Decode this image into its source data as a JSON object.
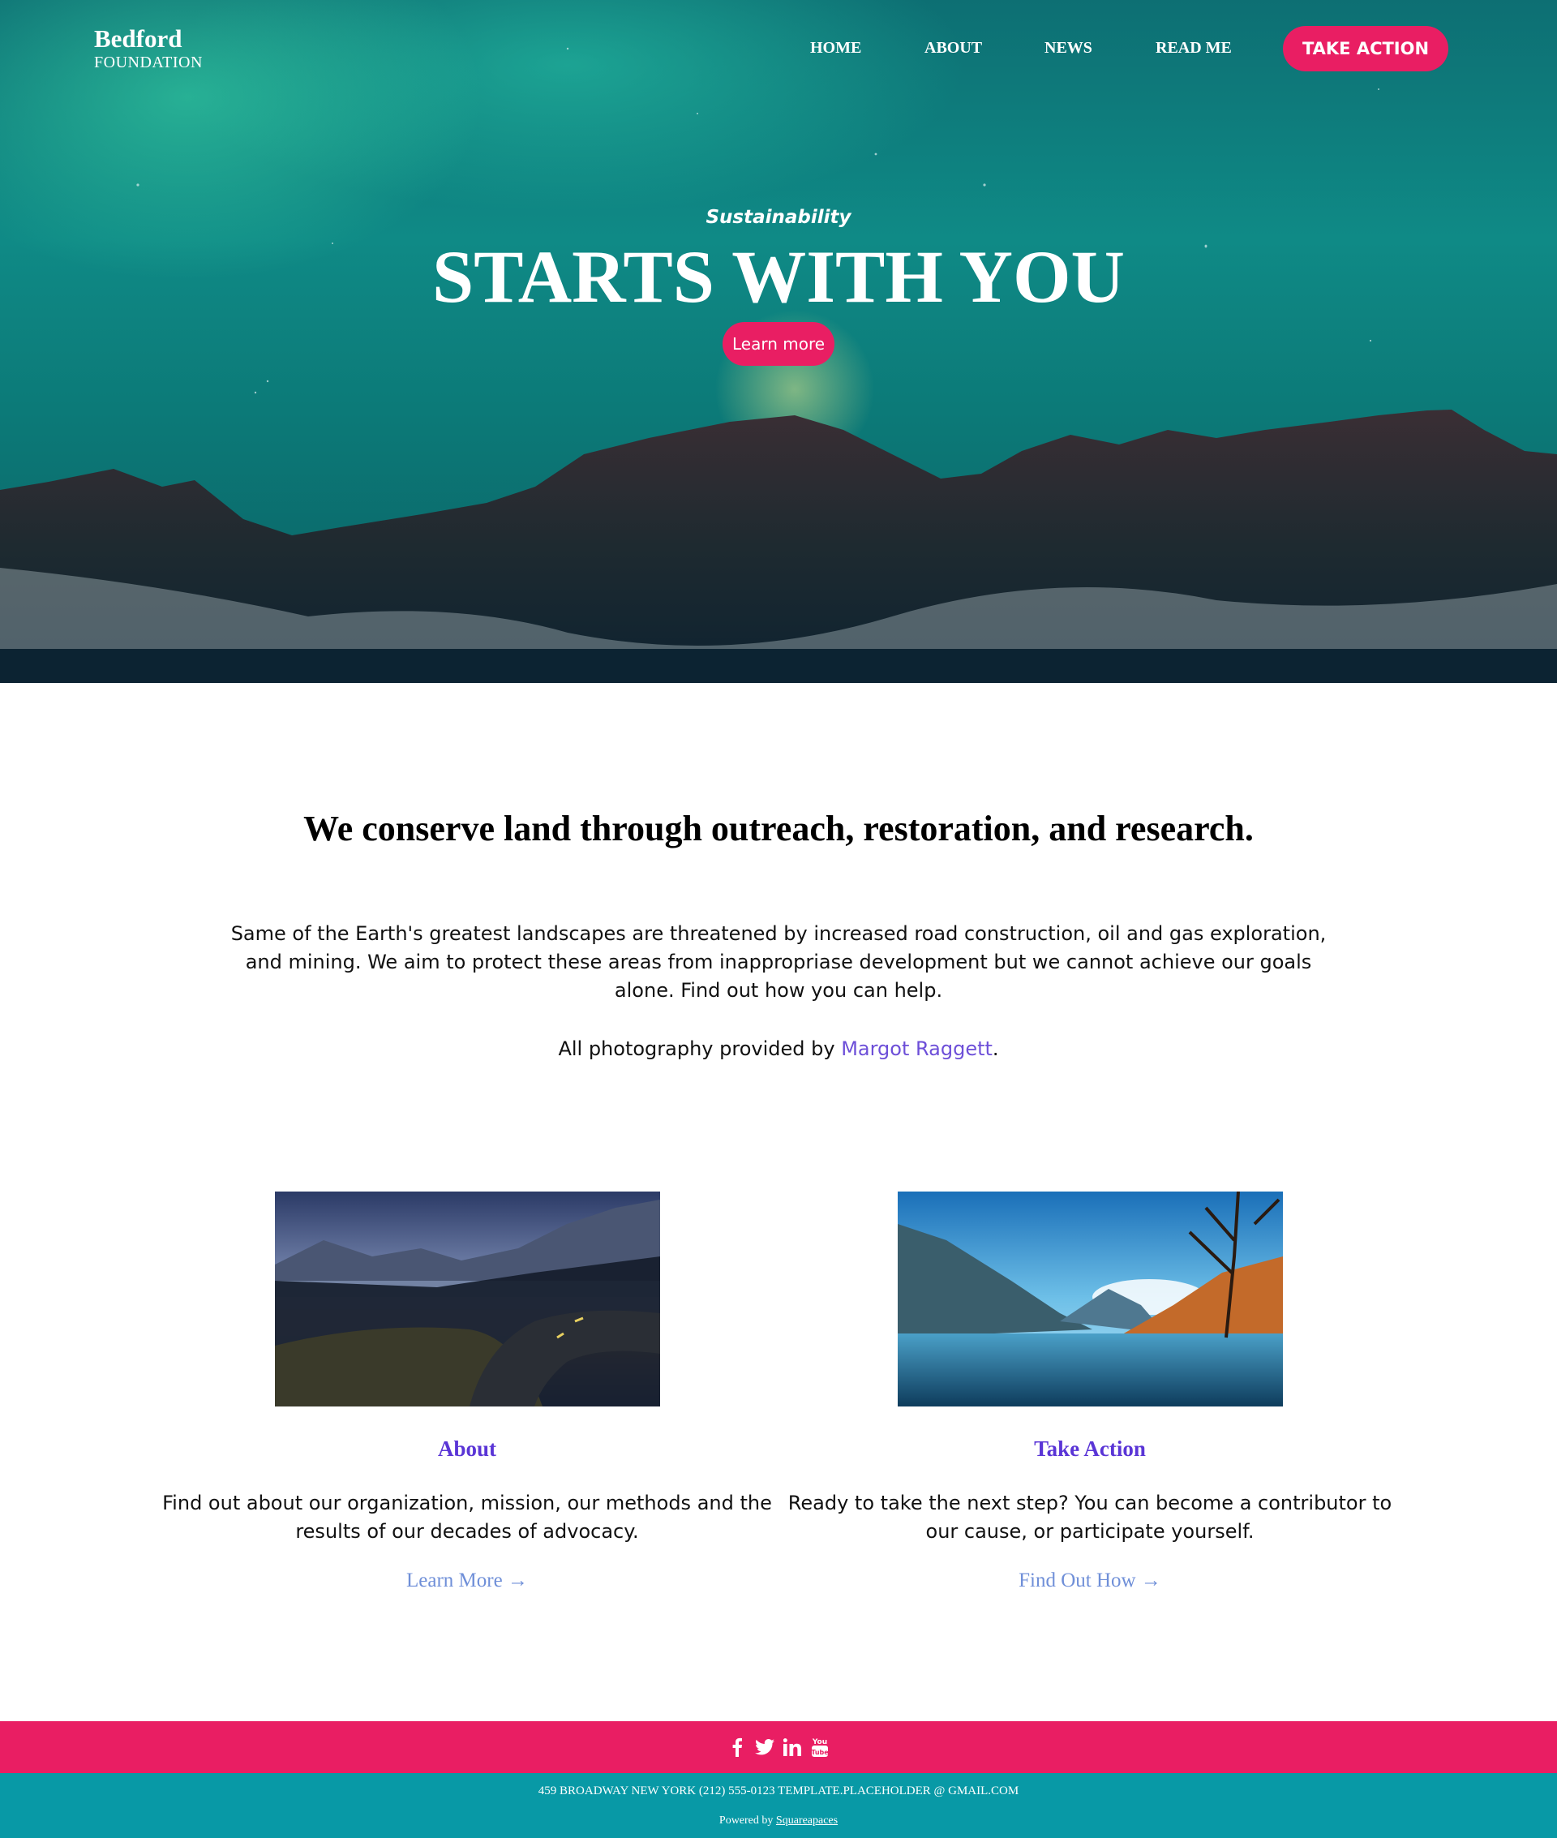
{
  "brand": {
    "name": "Bedford",
    "sub": "FOUNDATION"
  },
  "nav": {
    "home": "HOME",
    "about": "ABOUT",
    "news": "NEWS",
    "readme": "READ ME",
    "cta": "TAKE ACTION"
  },
  "hero": {
    "kicker": "Sustainability",
    "title": "STARTS WITH YOU",
    "button": "Learn more"
  },
  "intro": {
    "heading": "We conserve land through outreach, restoration, and research.",
    "paragraph": "Same of the Earth's greatest landscapes are threatened by increased road construction, oil and gas exploration, and mining. We aim to protect these areas from inappropriase development but we cannot achieve our goals alone. Find out how you can help.",
    "credit_prefix": "All photography provided by ",
    "credit_name": "Margot Raggett",
    "credit_suffix": "."
  },
  "cards": [
    {
      "title": "About",
      "text": "Find out about our organization, mission, our methods and the results of our decades of advocacy.",
      "link": "Learn More →"
    },
    {
      "title": "Take Action",
      "text": "Ready to take the next step? You can become a contributor to our cause, or participate yourself.",
      "link": "Find Out How →"
    }
  ],
  "footer": {
    "social": [
      "facebook-icon",
      "twitter-icon",
      "linkedin-icon",
      "youtube-icon"
    ],
    "address": "459 BROADWAY NEW YORK (212) 555-0123 TEMPLATE.PLACEHOLDER @ GMAIL.COM",
    "powered_prefix": "Powered by ",
    "powered_link": "Squareapaces"
  },
  "colors": {
    "accent": "#e91e63",
    "teal": "#0899a6",
    "heading_link": "#5a35d6",
    "link": "#6f8fd8"
  }
}
